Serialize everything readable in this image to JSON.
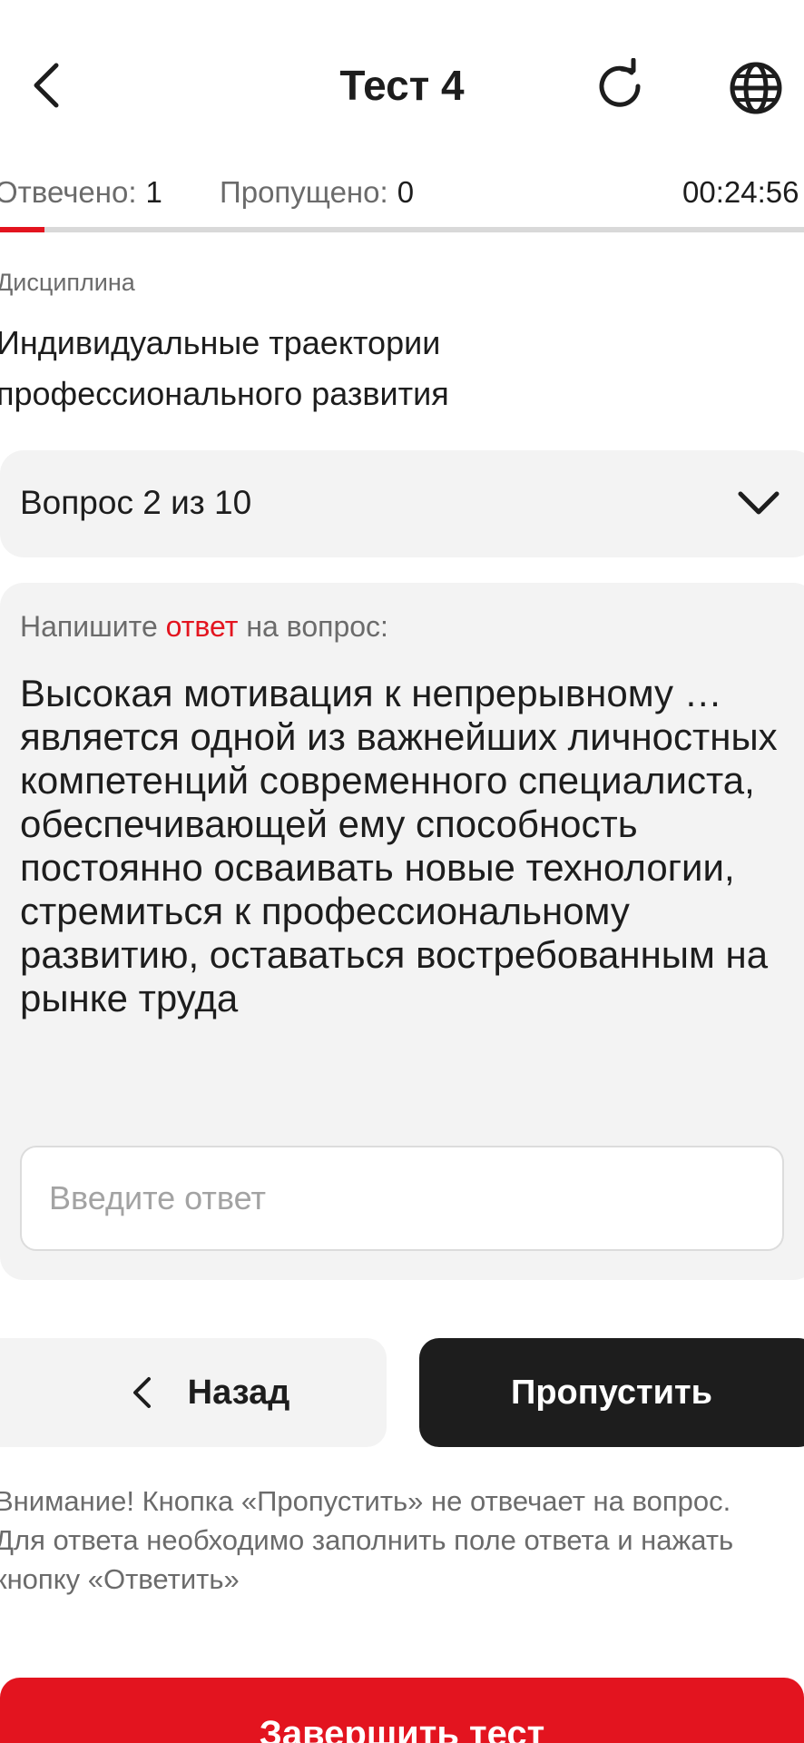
{
  "header": {
    "title": "Тест 4",
    "back_icon": "chevron-left-icon",
    "refresh_icon": "refresh-icon",
    "language_icon": "globe-icon"
  },
  "status": {
    "answered_label": "Отвечено:",
    "answered_value": "1",
    "skipped_label": "Пропущено:",
    "skipped_value": "0",
    "timer": "00:24:56",
    "progress_fraction": 0.055
  },
  "discipline": {
    "label": "Дисциплина",
    "name": "Индивидуальные траектории профессионального развития"
  },
  "question_selector": {
    "label": "Вопрос 2 из 10",
    "icon": "chevron-down-icon"
  },
  "question": {
    "prompt_before": "Напишите",
    "prompt_accent": "ответ",
    "prompt_after": "на вопрос:",
    "text": "Высокая мотивация к непрерывному … является одной из важнейших личностных компетенций современного специалиста, обеспечивающей ему способность постоянно осваивать новые технологии, стремиться к профессиональному развитию, оставаться востребованным на рынке труда",
    "answer_value": "",
    "answer_placeholder": "Введите ответ"
  },
  "buttons": {
    "back_label": "Назад",
    "skip_label": "Пропустить",
    "finish_label": "Завершить тест"
  },
  "notice": "Внимание! Кнопка «Пропустить» не отвечает на вопрос. Для ответа необходимо заполнить поле ответа и нажать кнопку «Ответить»",
  "colors": {
    "accent": "#e3141f",
    "dark": "#1d1d1d",
    "card_bg": "#f3f3f3",
    "muted_text": "#6b6b6b"
  }
}
